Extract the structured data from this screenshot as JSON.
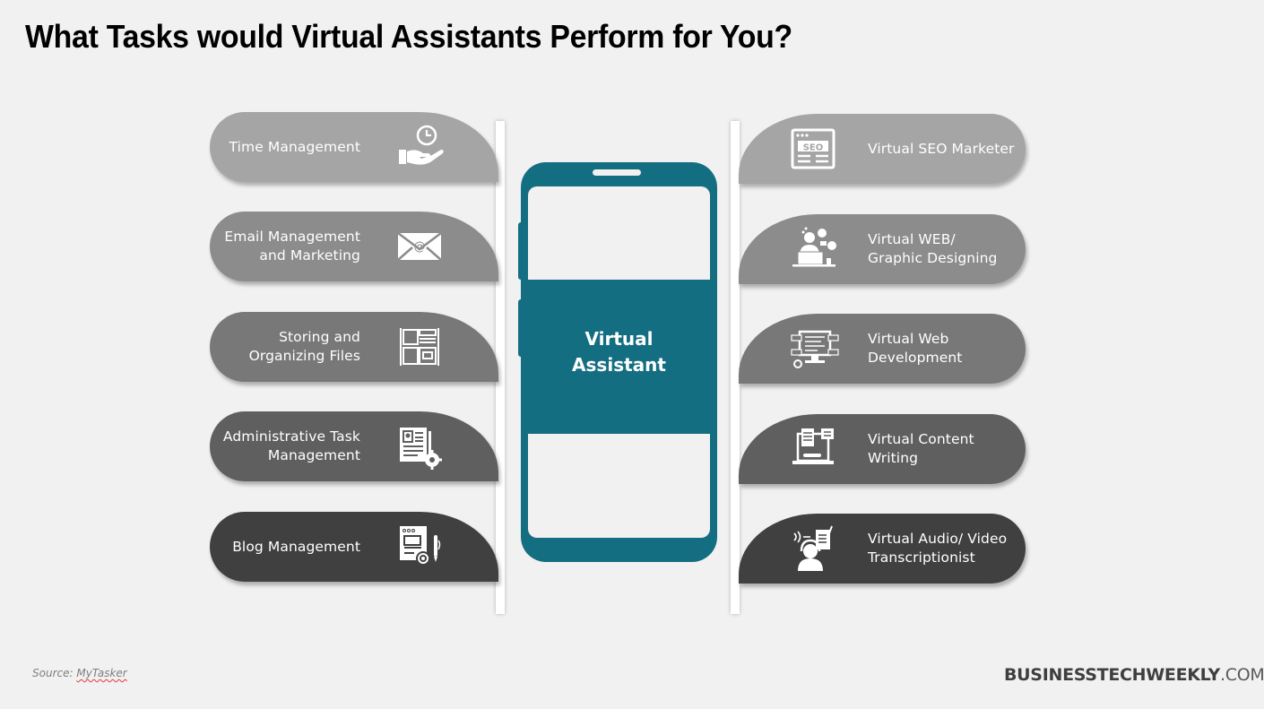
{
  "title": "What Tasks would Virtual Assistants Perform for You?",
  "center": {
    "label": "Virtual\nAssistant",
    "color": "#146e81"
  },
  "left_items": [
    {
      "label": "Time Management",
      "icon": "clock-hand-icon",
      "color": "#a5a5a5"
    },
    {
      "label": "Email Management\nand Marketing",
      "icon": "envelope-at-icon",
      "color": "#8c8c8c"
    },
    {
      "label": "Storing and\nOrganizing Files",
      "icon": "file-cabinet-icon",
      "color": "#787878"
    },
    {
      "label": "Administrative Task\nManagement",
      "icon": "document-gear-icon",
      "color": "#5f5f5f"
    },
    {
      "label": "Blog Management",
      "icon": "blog-gear-pen-icon",
      "color": "#404040"
    }
  ],
  "right_items": [
    {
      "label": "Virtual SEO Marketer",
      "icon": "seo-browser-icon",
      "color": "#a5a5a5"
    },
    {
      "label": "Virtual WEB/\nGraphic Designing",
      "icon": "designer-laptop-icon",
      "color": "#8c8c8c"
    },
    {
      "label": "Virtual Web\nDevelopment",
      "icon": "web-dev-monitor-icon",
      "color": "#787878"
    },
    {
      "label": "Virtual Content\nWriting",
      "icon": "content-writing-laptop-icon",
      "color": "#5f5f5f"
    },
    {
      "label": "Virtual Audio/ Video\nTranscriptionist",
      "icon": "transcriptionist-headset-icon",
      "color": "#404040"
    }
  ],
  "footer": {
    "source_prefix": "Source: ",
    "source_name": "MyTasker",
    "brand_bold": "BUSINESSTECHWEEKLY",
    "brand_suffix": ".COM"
  }
}
